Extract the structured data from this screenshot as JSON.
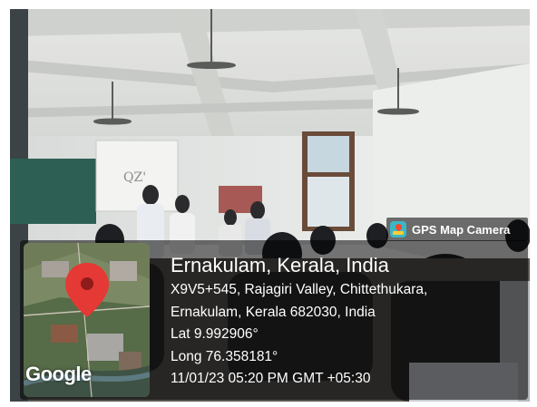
{
  "brand": {
    "icon": "map-pin-icon",
    "label": "GPS Map Camera"
  },
  "location": {
    "title": "Ernakulam, Kerala, India",
    "address_line1": "X9V5+545, Rajagiri Valley, Chittethukara,",
    "address_line2": "Ernakulam, Kerala 682030, India",
    "lat": "Lat 9.992906°",
    "long": "Long 76.358181°",
    "datetime": "11/01/23 05:20 PM GMT +05:30"
  },
  "map": {
    "pin_color": "#e53935",
    "provider_label": "Google"
  },
  "projector_screen_text": "QZ'"
}
